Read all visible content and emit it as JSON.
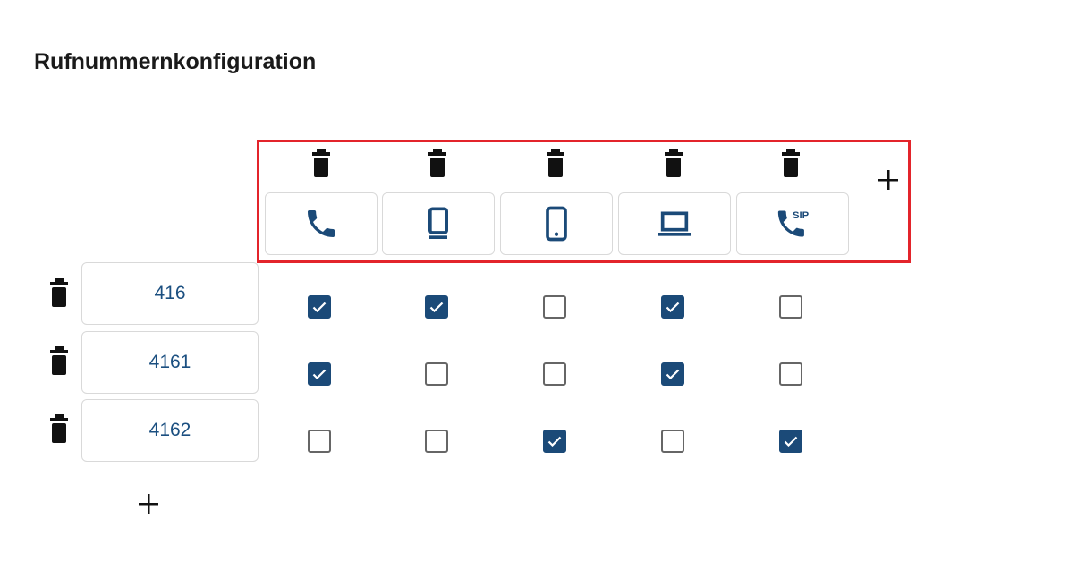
{
  "page": {
    "title": "Rufnummernkonfiguration"
  },
  "device_columns": [
    {
      "icon": "phone-icon"
    },
    {
      "icon": "desk-phone-icon"
    },
    {
      "icon": "mobile-phone-icon"
    },
    {
      "icon": "laptop-icon"
    },
    {
      "icon": "sip-phone-icon",
      "badge": "SIP"
    }
  ],
  "numbers": [
    {
      "value": "416",
      "assignments": [
        true,
        true,
        false,
        true,
        false
      ]
    },
    {
      "value": "4161",
      "assignments": [
        true,
        false,
        false,
        true,
        false
      ]
    },
    {
      "value": "4162",
      "assignments": [
        false,
        false,
        true,
        false,
        true
      ]
    }
  ],
  "colors": {
    "accent": "#1b4a78",
    "number_text": "#1b4f80",
    "highlight": "#e3242b",
    "icon_dark": "#111111",
    "border": "#d9d9d9"
  }
}
